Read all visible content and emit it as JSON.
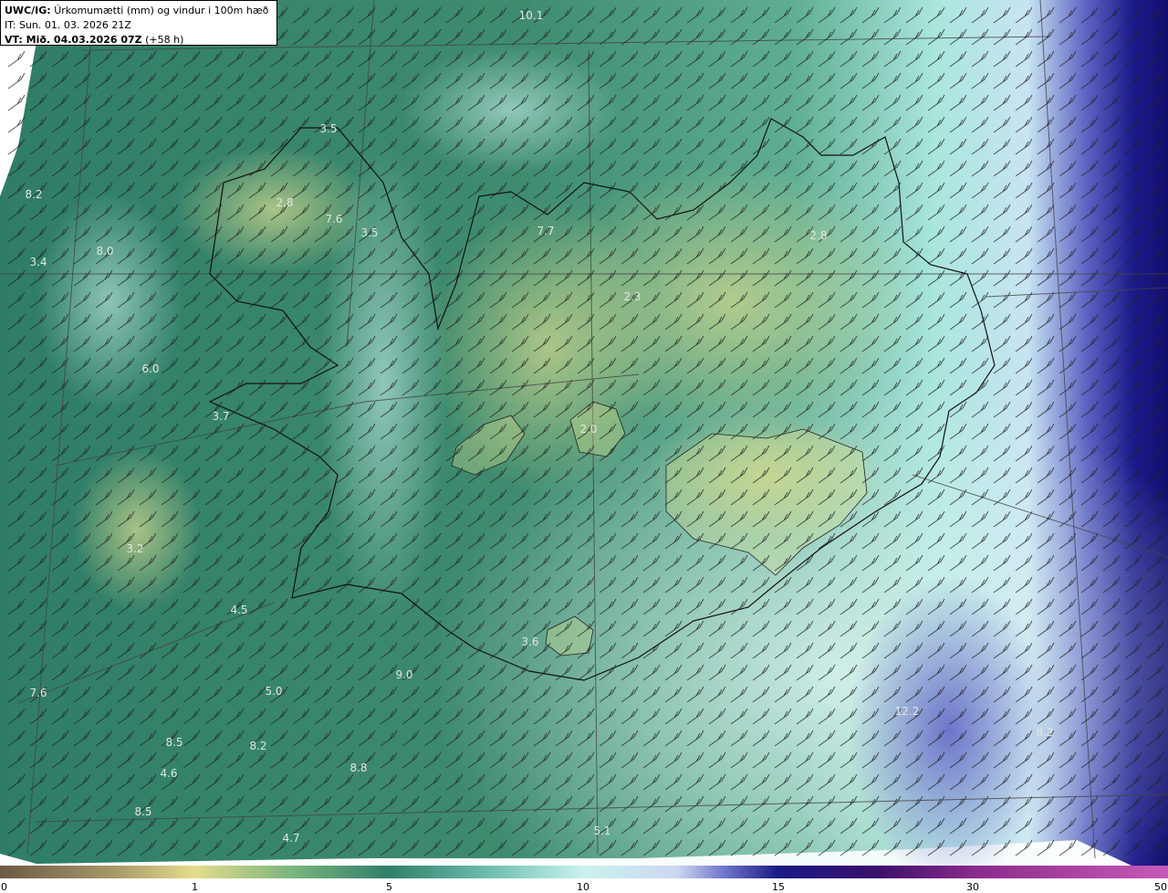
{
  "info": {
    "model": "UWC/IG:",
    "title": "Úrkomumætti (mm) og vindur i 100m hæð",
    "issue_time": "IT: Sun. 01. 03. 2026 21Z",
    "valid_label": "VT: Mið. 04.03.2026 07Z",
    "lead": "(+58 h)"
  },
  "legend": {
    "ticks": [
      "0",
      "1",
      "5",
      "10",
      "15",
      "30",
      "50"
    ],
    "colors": [
      "#6b5a44",
      "#a89a6b",
      "#e6dc8c",
      "#7ab57f",
      "#2f7f69",
      "#6fbfb2",
      "#c9f2ef",
      "#cdd6f2",
      "#6f75c8",
      "#1a1a86",
      "#3a0f6b",
      "#8a2a8c",
      "#c85ab8"
    ]
  },
  "map_labels": [
    {
      "text": "10.1",
      "id": "v1"
    },
    {
      "text": "3.5",
      "id": "v2"
    },
    {
      "text": "8.2",
      "id": "v3"
    },
    {
      "text": "2.8",
      "id": "v4"
    },
    {
      "text": "7.6",
      "id": "v5"
    },
    {
      "text": "3.5",
      "id": "v6"
    },
    {
      "text": "8.0",
      "id": "v7"
    },
    {
      "text": "3.4",
      "id": "v8"
    },
    {
      "text": "7.7",
      "id": "v9"
    },
    {
      "text": "2.8",
      "id": "v10"
    },
    {
      "text": "2.3",
      "id": "v11"
    },
    {
      "text": "6.0",
      "id": "v12"
    },
    {
      "text": "3.7",
      "id": "v13"
    },
    {
      "text": "2.0",
      "id": "v14"
    },
    {
      "text": "3.2",
      "id": "v15"
    },
    {
      "text": "4.5",
      "id": "v16"
    },
    {
      "text": "3.6",
      "id": "v17"
    },
    {
      "text": "9.0",
      "id": "v18"
    },
    {
      "text": "7.6",
      "id": "v19"
    },
    {
      "text": "5.0",
      "id": "v20"
    },
    {
      "text": "12.2",
      "id": "v21"
    },
    {
      "text": "8.2",
      "id": "v22"
    },
    {
      "text": "8.5",
      "id": "v23"
    },
    {
      "text": "8.2",
      "id": "v24"
    },
    {
      "text": "4.6",
      "id": "v25"
    },
    {
      "text": "8.8",
      "id": "v26"
    },
    {
      "text": "8.5",
      "id": "v27"
    },
    {
      "text": "4.7",
      "id": "v28"
    },
    {
      "text": "5.1",
      "id": "v29"
    }
  ]
}
